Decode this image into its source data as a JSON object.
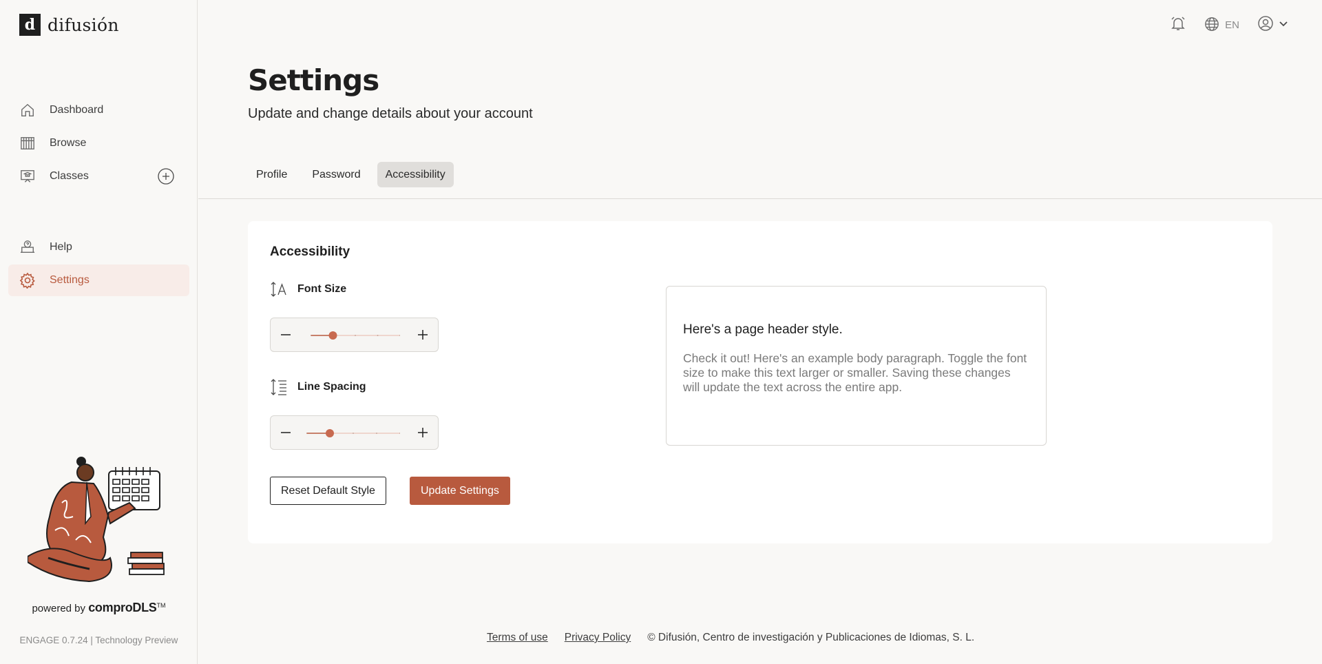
{
  "brand": {
    "logo_letter": "d",
    "name": "difusión"
  },
  "sidebar": {
    "items": [
      {
        "label": "Dashboard",
        "icon": "home-icon"
      },
      {
        "label": "Browse",
        "icon": "books-icon"
      },
      {
        "label": "Classes",
        "icon": "classroom-icon"
      },
      {
        "label": "Help",
        "icon": "help-icon"
      },
      {
        "label": "Settings",
        "icon": "gear-icon",
        "active": true
      }
    ],
    "powered_by": "powered by",
    "powered_brand": "comproDLS",
    "trademark": "TM",
    "version": "ENGAGE 0.7.24 | Technology Preview"
  },
  "topbar": {
    "language": "EN"
  },
  "header": {
    "title": "Settings",
    "subtitle": "Update and change details about your account"
  },
  "tabs": [
    {
      "label": "Profile"
    },
    {
      "label": "Password"
    },
    {
      "label": "Accessibility",
      "active": true
    }
  ],
  "accessibility": {
    "title": "Accessibility",
    "font_size_label": "Font Size",
    "line_spacing_label": "Line Spacing",
    "font_size_level": 1,
    "line_spacing_level": 1,
    "levels": 5,
    "reset_label": "Reset Default Style",
    "update_label": "Update Settings",
    "preview_title": "Here's a page header style.",
    "preview_body": "Check it out! Here's an example body paragraph. Toggle the font size to make this text larger or smaller. Saving these changes will update the text across the entire app."
  },
  "footer": {
    "terms": "Terms of use",
    "privacy": "Privacy Policy",
    "copyright": "© Difusión, Centro de investigación y Publicaciones de Idiomas, S. L."
  },
  "colors": {
    "accent": "#b85a3e",
    "active_bg": "#f8ece8"
  }
}
